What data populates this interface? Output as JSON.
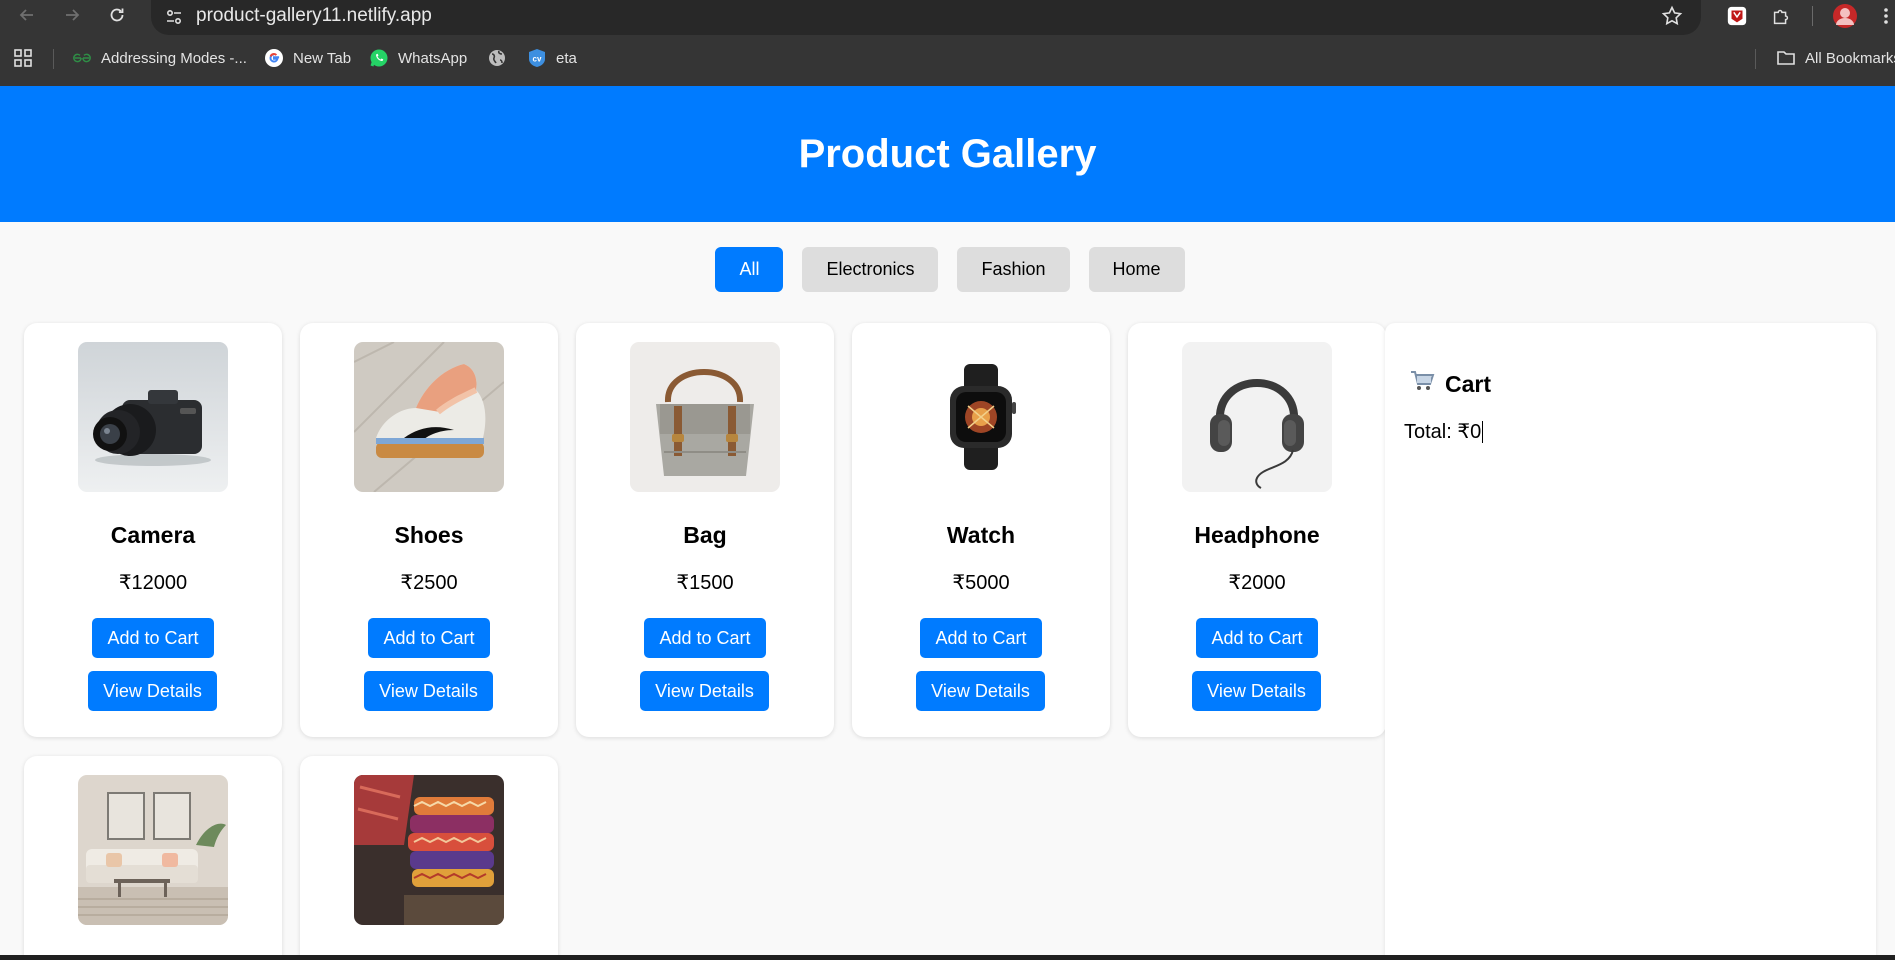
{
  "browser": {
    "url": "product-gallery11.netlify.app",
    "bookmarks": [
      {
        "label": "Addressing Modes -...",
        "icon": "geeksforgeeks-icon"
      },
      {
        "label": "New Tab",
        "icon": "google-icon"
      },
      {
        "label": "WhatsApp",
        "icon": "whatsapp-icon"
      },
      {
        "label": "",
        "icon": "globe-icon"
      },
      {
        "label": "eta",
        "icon": "cv-icon"
      }
    ],
    "all_bookmarks": "All Bookmarks"
  },
  "header": {
    "title": "Product Gallery"
  },
  "filters": [
    "All",
    "Electronics",
    "Fashion",
    "Home"
  ],
  "active_filter": "All",
  "buttons": {
    "add": "Add to Cart",
    "view": "View Details"
  },
  "products": [
    {
      "name": "Camera",
      "price": "₹12000",
      "image": "camera-image"
    },
    {
      "name": "Shoes",
      "price": "₹2500",
      "image": "shoes-image"
    },
    {
      "name": "Bag",
      "price": "₹1500",
      "image": "bag-image"
    },
    {
      "name": "Watch",
      "price": "₹5000",
      "image": "watch-image"
    },
    {
      "name": "Headphone",
      "price": "₹2000",
      "image": "headphone-image"
    },
    {
      "name": "",
      "price": "",
      "image": "sofa-image"
    },
    {
      "name": "",
      "price": "",
      "image": "cushions-image"
    }
  ],
  "cart": {
    "title": "Cart",
    "total": "Total: ₹0"
  },
  "colors": {
    "accent": "#007bff",
    "filter_inactive": "#dddddd",
    "chrome": "#353535",
    "omnibox": "#282828"
  }
}
